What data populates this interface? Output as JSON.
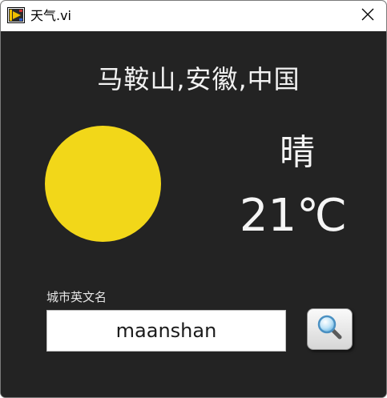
{
  "window": {
    "title": "天气.vi",
    "app_icon": "labview-vi-icon",
    "close_icon": "close-icon"
  },
  "weather": {
    "location": "马鞍山,安徽,中国",
    "condition": "晴",
    "temperature": "21℃",
    "condition_icon": "sun-icon"
  },
  "search": {
    "label": "城市英文名",
    "value": "maanshan",
    "button_icon": "magnifier-icon"
  },
  "colors": {
    "background": "#232323",
    "sun": "#f2d719",
    "text": "#f5f5f5"
  }
}
